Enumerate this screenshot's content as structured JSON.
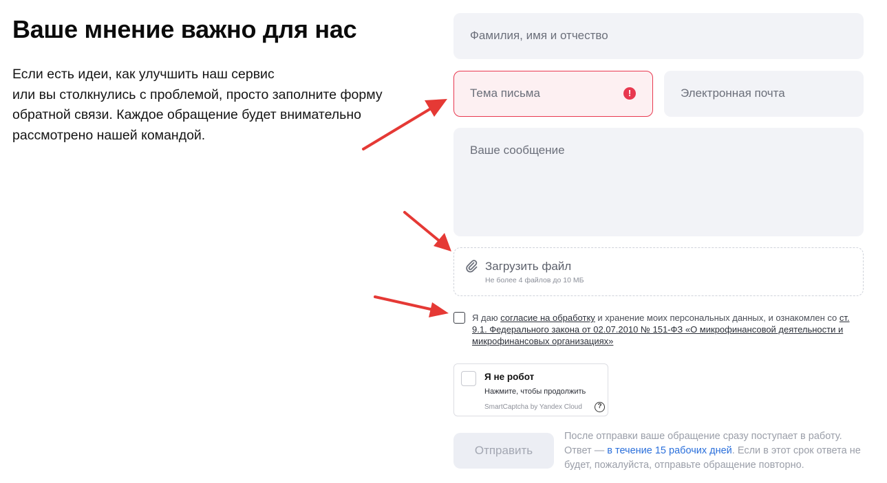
{
  "header": {
    "title": "Ваше мнение важно для нас",
    "description_lines": [
      "Если есть идеи, как улучшить наш сервис",
      "или вы столкнулись с проблемой, просто заполните форму",
      "обратной связи. Каждое обращение будет внимательно",
      "рассмотрено нашей командой."
    ]
  },
  "form": {
    "name_placeholder": "Фамилия, имя и отчество",
    "subject_placeholder": "Тема письма",
    "subject_error_icon": "!",
    "email_placeholder": "Электронная почта",
    "message_placeholder": "Ваше сообщение",
    "upload": {
      "label": "Загрузить файл",
      "hint": "Не более 4 файлов до 10 МБ"
    },
    "consent": {
      "text_1": "Я даю ",
      "link_1": "согласие на обработку",
      "text_2": " и хранение моих персональных данных, и ознакомлен со ",
      "link_2": "ст. 9.1. Федерального закона от 02.07.2010 № 151-ФЗ «О микрофинансовой деятельности и микрофинансовых организациях»",
      "checked": false
    },
    "captcha": {
      "title": "Я не робот",
      "subtitle": "Нажмите, чтобы продолжить",
      "brand": "SmartCaptcha by Yandex Cloud",
      "help": "?"
    },
    "submit_label": "Отправить",
    "note": {
      "part_1": "После отправки ваше обращение сразу поступает в работу. Ответ — ",
      "link": "в течение 15 рабочих дней",
      "part_2": ". Если в этот срок ответа не будет, пожалуйста, отправьте обращение повторно."
    }
  },
  "colors": {
    "error": "#e8384f",
    "field_bg": "#f2f3f7",
    "link": "#2a6fdb",
    "annotation_arrow": "#e53935"
  }
}
